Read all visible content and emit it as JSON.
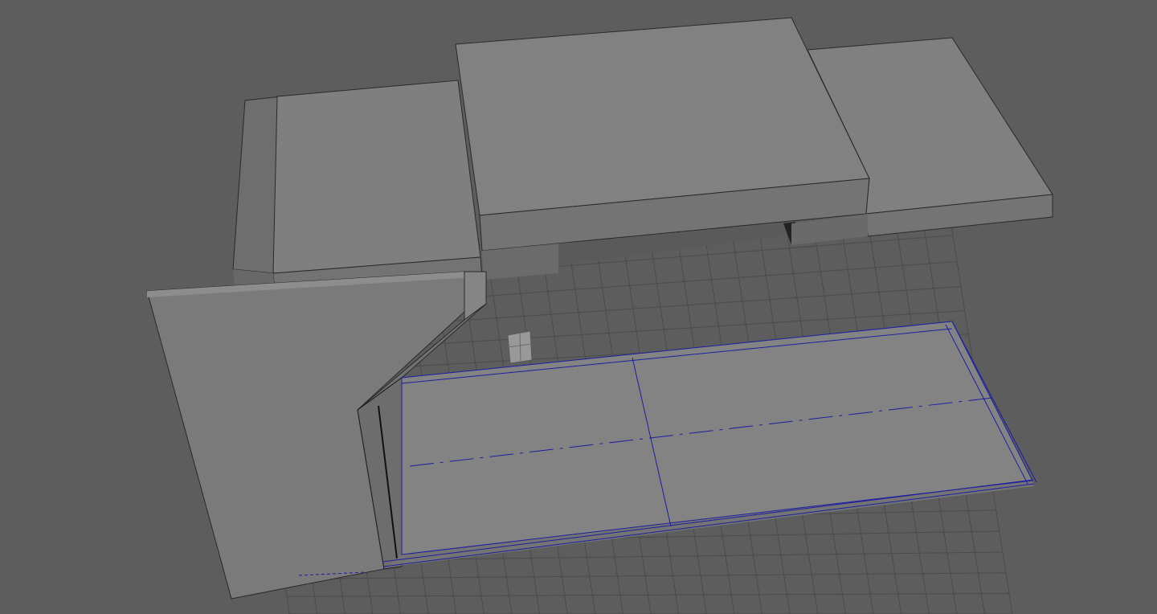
{
  "viewport": {
    "background_color": "#5d5d5d",
    "grid_color": "#4b4b4b",
    "wireframe_color": "#1d1f9e",
    "selected_object": "floor-slab"
  },
  "scene_objects": [
    {
      "id": "left-top-block",
      "kind": "block"
    },
    {
      "id": "center-top-block",
      "kind": "block"
    },
    {
      "id": "right-top-block",
      "kind": "block"
    },
    {
      "id": "angled-wall",
      "kind": "wall"
    },
    {
      "id": "floor-slab",
      "kind": "slab",
      "selected": true
    },
    {
      "id": "small-cube",
      "kind": "cube"
    }
  ]
}
